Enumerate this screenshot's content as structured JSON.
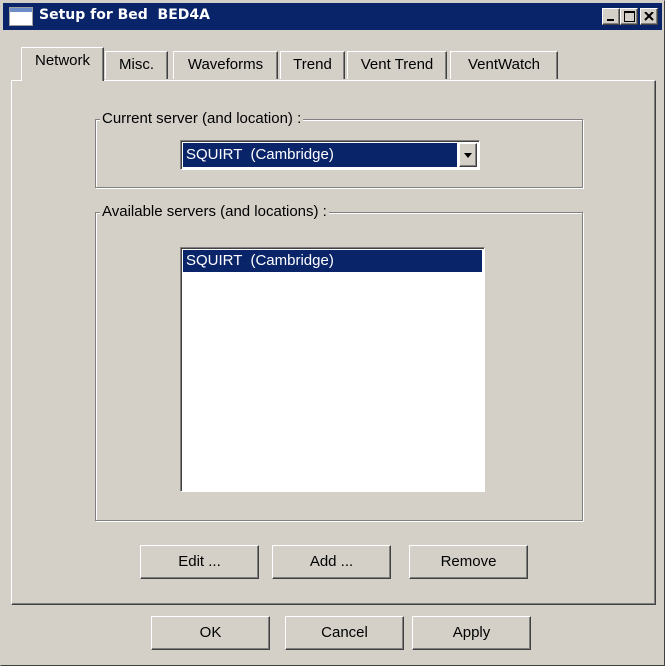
{
  "window": {
    "title": "Setup for Bed  BED4A",
    "icon": "window-icon",
    "controls": {
      "minimize": "minimize-icon",
      "maximize": "maximize-icon",
      "close": "close-icon"
    }
  },
  "tabs": [
    {
      "label": "Network",
      "active": true
    },
    {
      "label": "Misc.",
      "active": false
    },
    {
      "label": "Waveforms",
      "active": false
    },
    {
      "label": "Trend",
      "active": false
    },
    {
      "label": "Vent Trend",
      "active": false
    },
    {
      "label": "VentWatch",
      "active": false
    }
  ],
  "network": {
    "current_server": {
      "label": "Current server (and location) :",
      "selected": "SQUIRT  (Cambridge)"
    },
    "available_servers": {
      "label": "Available servers (and locations) :",
      "items": [
        "SQUIRT  (Cambridge)"
      ],
      "selected_index": 0
    },
    "buttons": {
      "edit": "Edit ...",
      "add": "Add ...",
      "remove": "Remove"
    }
  },
  "dialog_buttons": {
    "ok": "OK",
    "cancel": "Cancel",
    "apply": "Apply"
  },
  "colors": {
    "face": "#d4d0c8",
    "titlebar": "#0a246a",
    "selection": "#0a246a"
  }
}
